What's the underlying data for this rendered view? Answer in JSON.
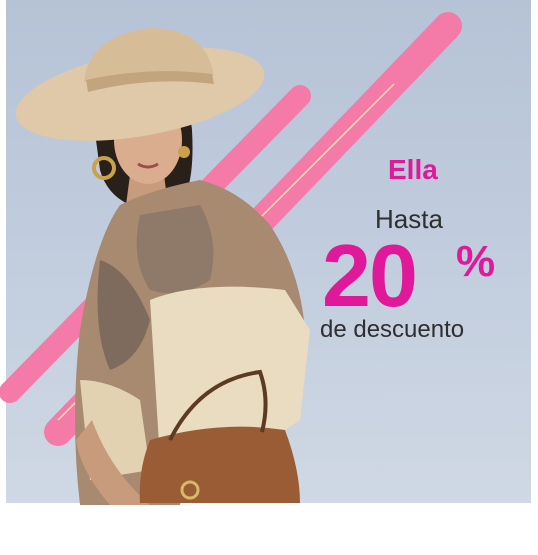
{
  "promo": {
    "category": "Ella",
    "intro": "Hasta",
    "discount_number": "20",
    "discount_symbol": "%",
    "suffix": "de descuento"
  },
  "colors": {
    "accent": "#e0199a",
    "stripe": "#f47ba7",
    "text": "#2f2f2f",
    "background": "#c3cedd"
  }
}
